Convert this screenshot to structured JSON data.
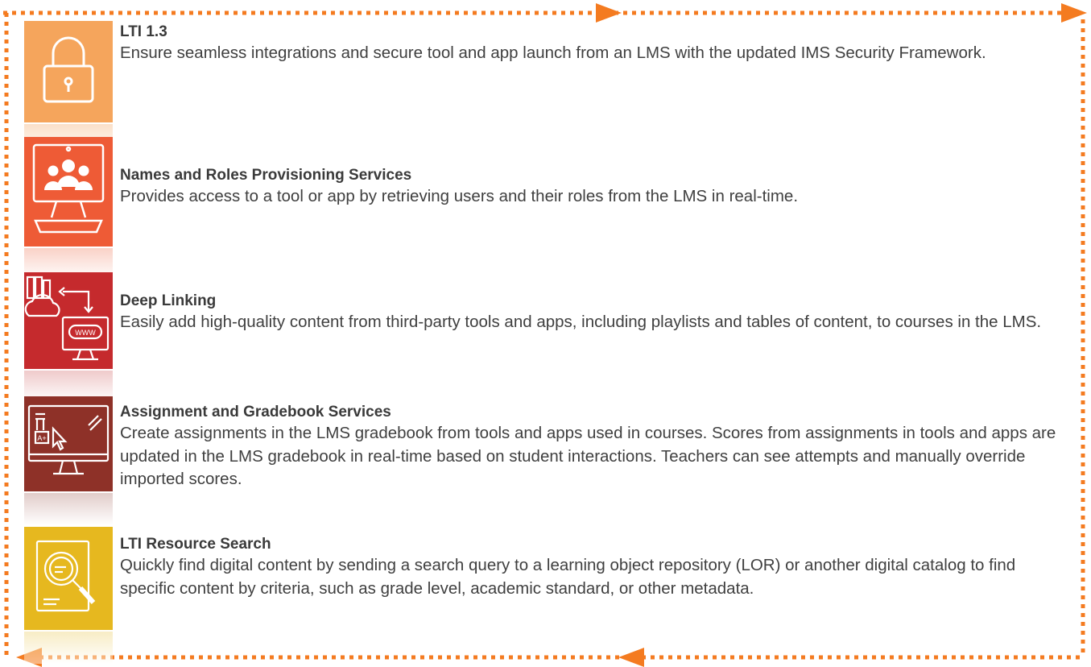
{
  "colors": {
    "border": "#f47b20",
    "tile_lti": "#f5a55c",
    "tile_nrps": "#ee5b36",
    "tile_deep": "#c52a2d",
    "tile_ags": "#8e3128",
    "tile_search": "#e6b81f"
  },
  "features": [
    {
      "icon": "padlock-icon",
      "title": "LTI 1.3",
      "description": "Ensure seamless integrations and secure tool and app launch from an LMS with the updated IMS Security Framework."
    },
    {
      "icon": "users-monitor-icon",
      "title": "Names and Roles Provisioning Services",
      "description": "Provides access to a tool or app by retrieving users and their roles from the LMS in real-time."
    },
    {
      "icon": "deep-linking-icon",
      "title": "Deep Linking",
      "description": "Easily add high-quality content from third-party tools and apps, including playlists and tables of content, to courses in the LMS."
    },
    {
      "icon": "gradebook-monitor-icon",
      "title": "Assignment and Gradebook Services",
      "description": "Create assignments in the LMS gradebook from tools and apps used in courses. Scores from assignments in tools and apps are updated in the LMS gradebook in real-time based on student interactions. Teachers can see attempts and manually override imported scores."
    },
    {
      "icon": "document-search-icon",
      "title": "LTI Resource Search",
      "description": "Quickly find digital content by sending a search query to a learning object repository (LOR) or another digital catalog to find specific content by criteria, such as grade level, academic standard, or other metadata."
    }
  ],
  "tile_label_www": "WWW",
  "tile_label_grade": "A+"
}
